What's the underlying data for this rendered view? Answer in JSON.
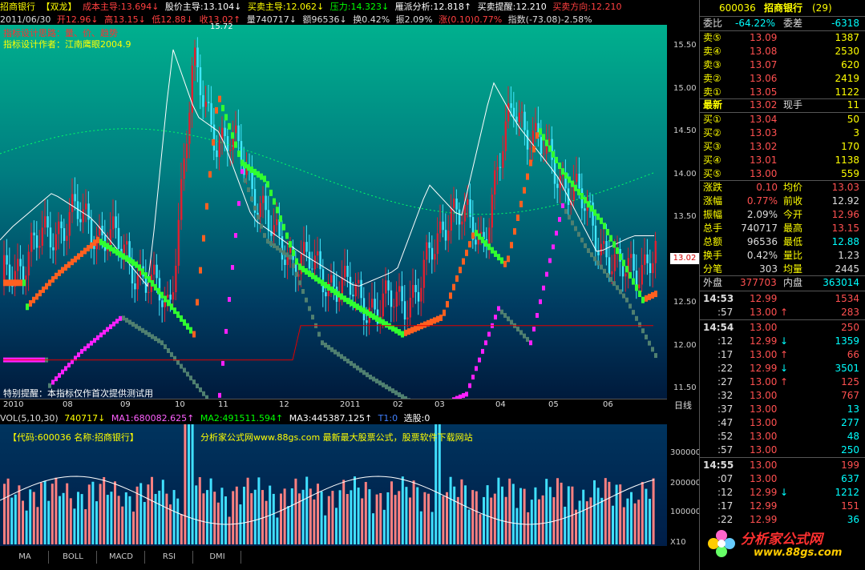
{
  "header": {
    "stock_name": "招商银行",
    "indicator": "【双龙】",
    "cost_main": "成本主导:13.694↓",
    "price_main": "股价主导:13.104↓",
    "buysell_main": "买卖主导:12.062↓",
    "pressure": "压力:14.323↓",
    "flock": "雁派分析:12.818↑",
    "buysell_alert": "买卖提醒:12.210",
    "buysell_dir": "买卖方向:12.210"
  },
  "infobar": {
    "date": "2011/06/30",
    "open": "开12.96↓",
    "high": "高13.15↓",
    "low": "低12.88↓",
    "close": "收13.02↑",
    "vol": "量740717↓",
    "amt": "额96536↓",
    "turnover": "换0.42%",
    "amp": "振2.09%",
    "change": "涨(0.10)0.77%",
    "index": "指数(-73.08)-2.58%"
  },
  "chart_notes": {
    "designer_idea": "指标设计思路：量、价、趋势",
    "designer": "指标设计作者：江南鹰眼2004.9",
    "peak": "15.72",
    "special_alert": "特别提醒：本指标仅作首次提供测试用",
    "current_price_tag": "13.02"
  },
  "yaxis": [
    "15.50",
    "15.00",
    "14.50",
    "14.00",
    "13.50",
    "13.00",
    "12.50",
    "12.00",
    "11.50"
  ],
  "xaxis": [
    "2010",
    "08",
    "09",
    "10",
    "11",
    "12",
    "2011",
    "02",
    "03",
    "04",
    "05",
    "06"
  ],
  "x_axis_period": "日线",
  "volume": {
    "label": "VOL(5,10,30)",
    "value": "740717↓",
    "ma1": "MA1:680082.625↑",
    "ma2": "MA2:491511.594↑",
    "ma3": "MA3:445387.125↑",
    "t1": "T1:0",
    "select": "选股:0",
    "code_info": "【代码:600036 名称:招商银行】",
    "site": "分析家公式网www.88gs.com 最新最大股票公式，股票软件下载网站",
    "axis": [
      "300000",
      "200000",
      "100000"
    ],
    "axis_unit": "X10"
  },
  "tabs": [
    "MA",
    "BOLL",
    "MACD",
    "RSI",
    "DMI"
  ],
  "panel": {
    "code": "600036",
    "name": "招商银行",
    "count": "(29)",
    "wei_bi_label": "委比",
    "wei_bi": "-64.22%",
    "wei_cha_label": "委差",
    "wei_cha": "-6318",
    "asks": [
      {
        "label": "卖⑤",
        "price": "13.09",
        "vol": "1387"
      },
      {
        "label": "卖④",
        "price": "13.08",
        "vol": "2530"
      },
      {
        "label": "卖③",
        "price": "13.07",
        "vol": "620"
      },
      {
        "label": "卖②",
        "price": "13.06",
        "vol": "2419"
      },
      {
        "label": "卖①",
        "price": "13.05",
        "vol": "1122"
      }
    ],
    "latest_label": "最新",
    "latest": "13.02",
    "now_hand_label": "现手",
    "now_hand": "11",
    "bids": [
      {
        "label": "买①",
        "price": "13.04",
        "vol": "50"
      },
      {
        "label": "买②",
        "price": "13.03",
        "vol": "3"
      },
      {
        "label": "买③",
        "price": "13.02",
        "vol": "170"
      },
      {
        "label": "买④",
        "price": "13.01",
        "vol": "1138"
      },
      {
        "label": "买⑤",
        "price": "13.00",
        "vol": "559"
      }
    ],
    "stats": [
      {
        "l1": "涨跌",
        "v1": "0.10",
        "l2": "均价",
        "v2": "13.03",
        "c1": "#ff5050",
        "c2": "#ff5050"
      },
      {
        "l1": "涨幅",
        "v1": "0.77%",
        "l2": "前收",
        "v2": "12.92",
        "c1": "#ff5050",
        "c2": "#ddd"
      },
      {
        "l1": "振幅",
        "v1": "2.09%",
        "l2": "今开",
        "v2": "12.96",
        "c1": "#ddd",
        "c2": "#ff5050"
      },
      {
        "l1": "总手",
        "v1": "740717",
        "l2": "最高",
        "v2": "13.15",
        "c1": "#ddd",
        "c2": "#ff5050"
      },
      {
        "l1": "总额",
        "v1": "96536",
        "l2": "最低",
        "v2": "12.88",
        "c1": "#ddd",
        "c2": "#00ffff"
      },
      {
        "l1": "换手",
        "v1": "0.42%",
        "l2": "量比",
        "v2": "1.23",
        "c1": "#ddd",
        "c2": "#ddd"
      },
      {
        "l1": "分笔",
        "v1": "303",
        "l2": "均量",
        "v2": "2445",
        "c1": "#ddd",
        "c2": "#ddd"
      }
    ],
    "outer_label": "外盘",
    "outer": "377703",
    "inner_label": "内盘",
    "inner": "363014",
    "ticks": [
      {
        "t": "14:53",
        "p": "12.99",
        "a": "",
        "v": "1534",
        "vc": "#ff5050",
        "major": true
      },
      {
        "t": ":57",
        "p": "13.00",
        "a": "↑",
        "v": "283",
        "vc": "#ff5050",
        "major": false
      },
      {
        "t": "14:54",
        "p": "13.00",
        "a": "",
        "v": "250",
        "vc": "#ff5050",
        "major": true
      },
      {
        "t": ":12",
        "p": "12.99",
        "a": "↓",
        "v": "1359",
        "vc": "#00ffff",
        "major": false
      },
      {
        "t": ":17",
        "p": "13.00",
        "a": "↑",
        "v": "66",
        "vc": "#ff5050",
        "major": false
      },
      {
        "t": ":22",
        "p": "12.99",
        "a": "↓",
        "v": "3501",
        "vc": "#00ffff",
        "major": false
      },
      {
        "t": ":27",
        "p": "13.00",
        "a": "↑",
        "v": "125",
        "vc": "#ff5050",
        "major": false
      },
      {
        "t": ":32",
        "p": "13.00",
        "a": "",
        "v": "767",
        "vc": "#ff5050",
        "major": false
      },
      {
        "t": ":37",
        "p": "13.00",
        "a": "",
        "v": "13",
        "vc": "#00ffff",
        "major": false
      },
      {
        "t": ":47",
        "p": "13.00",
        "a": "",
        "v": "277",
        "vc": "#00ffff",
        "major": false
      },
      {
        "t": ":52",
        "p": "13.00",
        "a": "",
        "v": "48",
        "vc": "#00ffff",
        "major": false
      },
      {
        "t": ":57",
        "p": "13.00",
        "a": "",
        "v": "250",
        "vc": "#00ffff",
        "major": false
      },
      {
        "t": "14:55",
        "p": "13.00",
        "a": "",
        "v": "199",
        "vc": "#ff5050",
        "major": true
      },
      {
        "t": ":07",
        "p": "13.00",
        "a": "",
        "v": "637",
        "vc": "#00ffff",
        "major": false
      },
      {
        "t": ":12",
        "p": "12.99",
        "a": "↓",
        "v": "1212",
        "vc": "#00ffff",
        "major": false
      },
      {
        "t": ":17",
        "p": "12.99",
        "a": "",
        "v": "151",
        "vc": "#ff5050",
        "major": false
      },
      {
        "t": ":22",
        "p": "12.99",
        "a": "",
        "v": "36",
        "vc": "#00ffff",
        "major": false
      }
    ],
    "logo_text": "分析家公式网",
    "logo_url": "www.88gs.com"
  },
  "colors": {
    "up": "#ff3030",
    "down": "#00ffff",
    "yellow": "#ffff00",
    "gray": "#c0c0c0"
  }
}
